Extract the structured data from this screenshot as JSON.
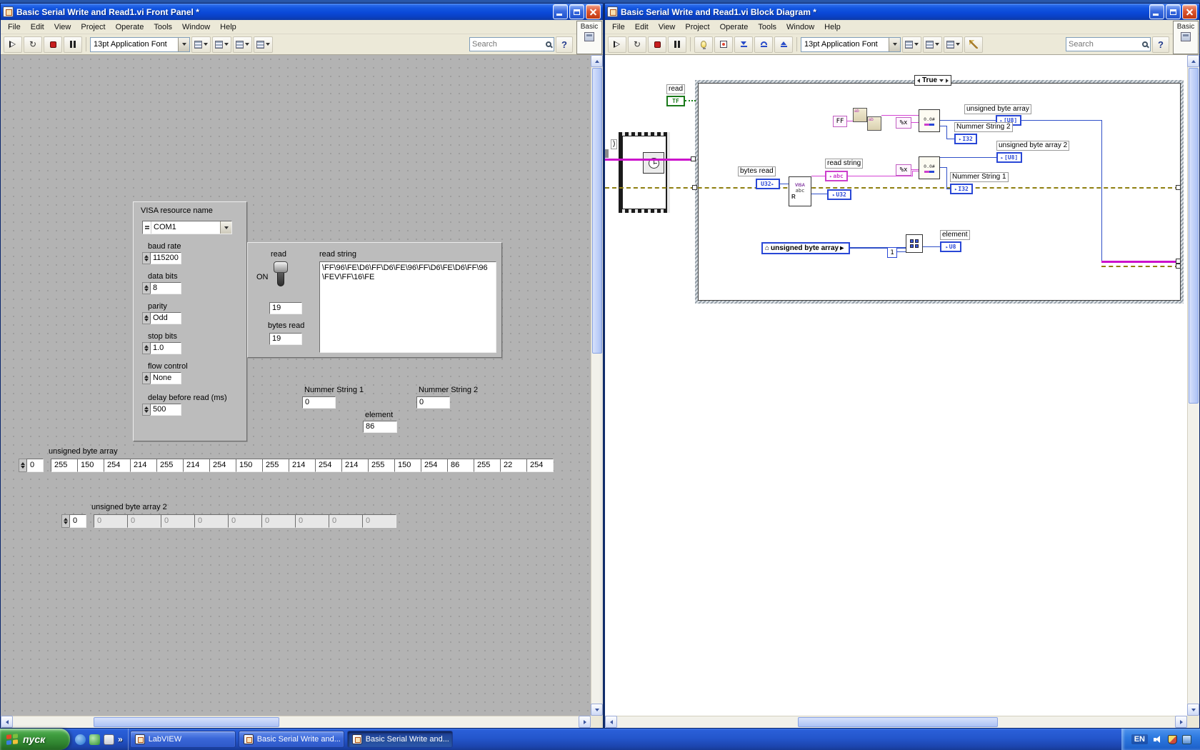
{
  "icons": {
    "help": "?",
    "chevron": "»",
    "house": "⌂",
    "run_continuous": "↻",
    "term_arrow": "▸"
  },
  "menu_items": [
    "File",
    "Edit",
    "View",
    "Project",
    "Operate",
    "Tools",
    "Window",
    "Help"
  ],
  "toolbar": {
    "font_selector": "13pt Application Font",
    "search_placeholder": "Search",
    "basic_label": "Basic"
  },
  "front_panel": {
    "window_title": "Basic Serial Write and Read1.vi Front Panel *",
    "visa_label": "VISA resource name",
    "visa_value": "COM1",
    "settings": [
      {
        "label": "baud rate",
        "value": "115200"
      },
      {
        "label": "data bits",
        "value": "8"
      },
      {
        "label": "parity",
        "value": "Odd"
      },
      {
        "label": "stop bits",
        "value": "1.0"
      },
      {
        "label": "flow control",
        "value": "None"
      },
      {
        "label": "delay before read (ms)",
        "value": "500"
      }
    ],
    "read": {
      "label": "read",
      "on": "ON",
      "numeric": "19",
      "bytes_read_label": "bytes read",
      "bytes_read": "19",
      "string_label": "read string",
      "string_value": "\\FF\\96\\FE\\D6\\FF\\D6\\FE\\96\\FF\\D6\\FE\\D6\\FF\\96\\FEV\\FF\\16\\FE"
    },
    "nummer1_label": "Nummer String 1",
    "nummer1_value": "0",
    "nummer2_label": "Nummer String 2",
    "nummer2_value": "0",
    "element_label": "element",
    "element_value": "86",
    "byte_array": {
      "label": "unsigned byte array",
      "index": "0",
      "values": [
        "255",
        "150",
        "254",
        "214",
        "255",
        "214",
        "254",
        "150",
        "255",
        "214",
        "254",
        "214",
        "255",
        "150",
        "254",
        "86",
        "255",
        "22",
        "254"
      ]
    },
    "byte_array2": {
      "label": "unsigned byte array 2",
      "index": "0",
      "values": [
        "0",
        "0",
        "0",
        "0",
        "0",
        "0",
        "0",
        "0",
        "0"
      ]
    }
  },
  "block_diagram": {
    "window_title": "Basic Serial Write and Read1.vi Block Diagram *",
    "case_selector": "True",
    "cut_label": ")",
    "read_label": "read",
    "tf": "TF",
    "bytes_read_label": "bytes read",
    "u32": "U32",
    "visa": {
      "l1": "VISA",
      "l2": "abc",
      "l3": "R"
    },
    "read_string_label": "read string",
    "abc": "abc",
    "ff": "FF",
    "format_x": "%x",
    "scan_glyph": "0.0#",
    "u8_array": "[U8]",
    "i32": "I32",
    "u8": "U8",
    "byte_array_label": "unsigned byte array",
    "byte_array2_label": "unsigned byte array 2",
    "nummer2_label": "Nummer String 2",
    "nummer1_label": "Nummer String 1",
    "element_label": "element",
    "local_variable": "unsigned byte array",
    "index_constant": "1"
  },
  "taskbar": {
    "start": "пуск",
    "buttons": [
      "LabVIEW",
      "Basic Serial Write and...",
      "Basic Serial Write and..."
    ],
    "language": "EN"
  }
}
